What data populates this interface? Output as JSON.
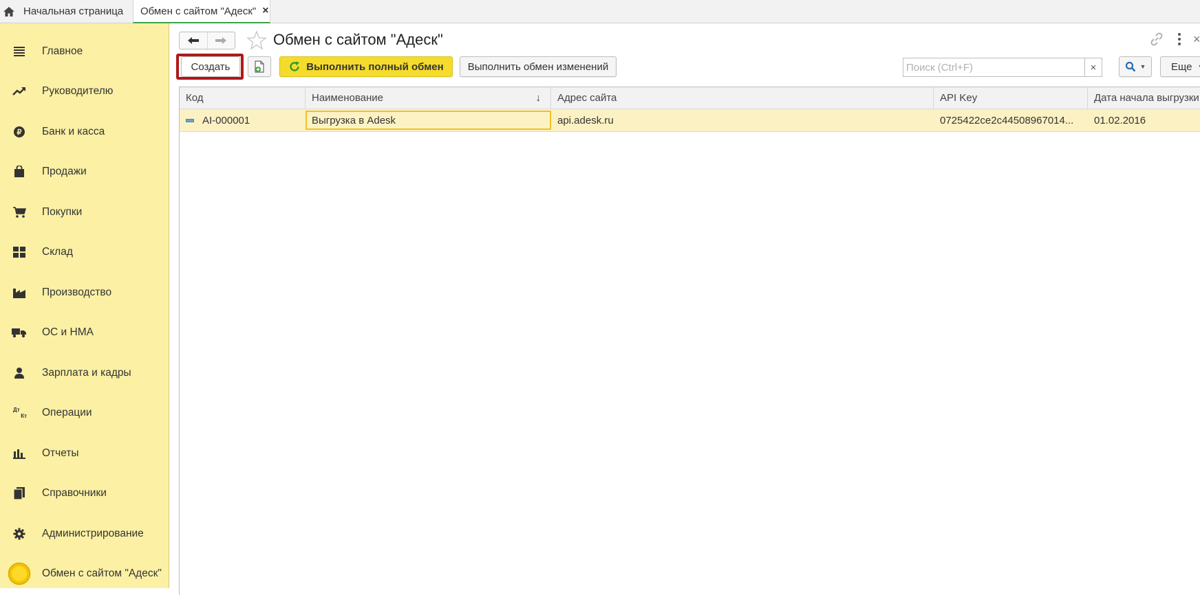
{
  "tabs": {
    "home_label": "Начальная страница",
    "active_label": "Обмен с сайтом \"Адеск\"",
    "close_glyph": "×"
  },
  "sidebar": {
    "items": [
      {
        "label": "Главное",
        "icon": "menu-lines-icon"
      },
      {
        "label": "Руководителю",
        "icon": "trend-up-icon"
      },
      {
        "label": "Банк и касса",
        "icon": "ruble-coin-icon"
      },
      {
        "label": "Продажи",
        "icon": "shopping-bag-icon"
      },
      {
        "label": "Покупки",
        "icon": "cart-icon"
      },
      {
        "label": "Склад",
        "icon": "warehouse-icon"
      },
      {
        "label": "Производство",
        "icon": "factory-icon"
      },
      {
        "label": "ОС и НМА",
        "icon": "truck-icon"
      },
      {
        "label": "Зарплата и кадры",
        "icon": "person-icon"
      },
      {
        "label": "Операции",
        "icon": "dt-kt-icon"
      },
      {
        "label": "Отчеты",
        "icon": "bar-chart-icon"
      },
      {
        "label": "Справочники",
        "icon": "books-icon"
      },
      {
        "label": "Администрирование",
        "icon": "gear-icon"
      },
      {
        "label": "Обмен с сайтом \"Адеск\"",
        "icon": "yellow-circle-icon"
      }
    ],
    "dt_label": "Дт",
    "kt_label": "Кт"
  },
  "header": {
    "title": "Обмен с сайтом \"Адеск\""
  },
  "toolbar": {
    "create_label": "Создать",
    "full_exchange_label": "Выполнить полный обмен",
    "changes_exchange_label": "Выполнить обмен изменений",
    "search_placeholder": "Поиск (Ctrl+F)",
    "search_clear": "×",
    "more_label": "Еще"
  },
  "table": {
    "columns": [
      "Код",
      "Наименование",
      "Адрес сайта",
      "API Key",
      "Дата начала выгрузки"
    ],
    "sort_indicator": "↓",
    "rows": [
      {
        "code": "AI-000001",
        "name": "Выгрузка в Adesk",
        "site": "api.adesk.ru",
        "api_key": "0725422ce2c44508967014...",
        "start_date": "01.02.2016"
      }
    ]
  },
  "colors": {
    "sidebar_bg": "#fbf0a4",
    "primary_button": "#f5dc2c",
    "highlight_border": "#b01818",
    "selected_row": "#fcf1c3"
  }
}
